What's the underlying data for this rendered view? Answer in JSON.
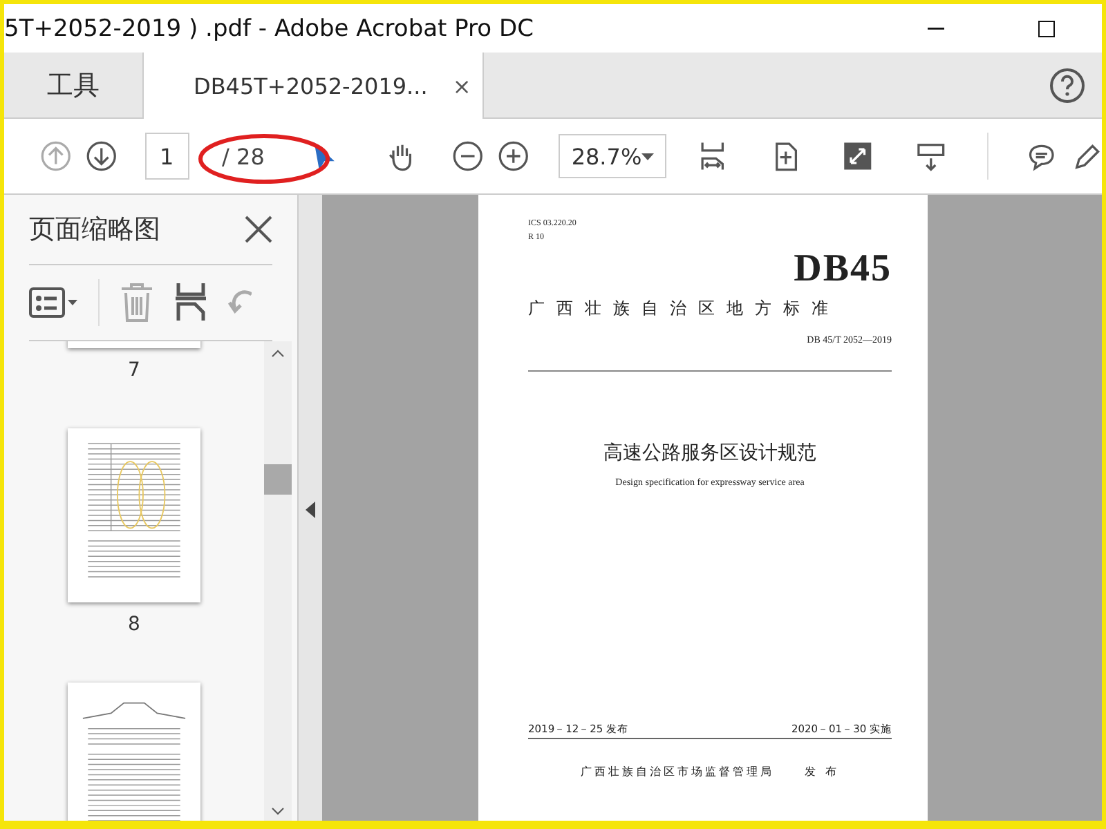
{
  "window": {
    "title": "5T+2052-2019 ) .pdf - Adobe Acrobat Pro DC"
  },
  "tabs": [
    {
      "label": "工具",
      "selected": false
    },
    {
      "label": "DB45T+2052-2019...",
      "selected": true,
      "close": "×"
    }
  ],
  "toolbar": {
    "page_number": "1",
    "page_total": "/ 28",
    "zoom": "28.7%"
  },
  "sidebar": {
    "title": "页面缩略图",
    "thumbnails": [
      {
        "kind": "cut",
        "label": "7"
      },
      {
        "kind": "table",
        "label": "8"
      },
      {
        "kind": "diagram"
      }
    ]
  },
  "document": {
    "ics": "ICS  03.220.20",
    "code": "R 10",
    "logo": "DB45",
    "authority": "广西壮族自治区地方标准",
    "number": "DB 45/T 2052—2019",
    "title_cn": "高速公路服务区设计规范",
    "title_en": "Design specification for expressway service area",
    "issue_date": "2019－12－25 发布",
    "effective_date": "2020－01－30 实施",
    "publisher": "广西壮族自治区市场监督管理局",
    "publish_word": "发 布"
  }
}
